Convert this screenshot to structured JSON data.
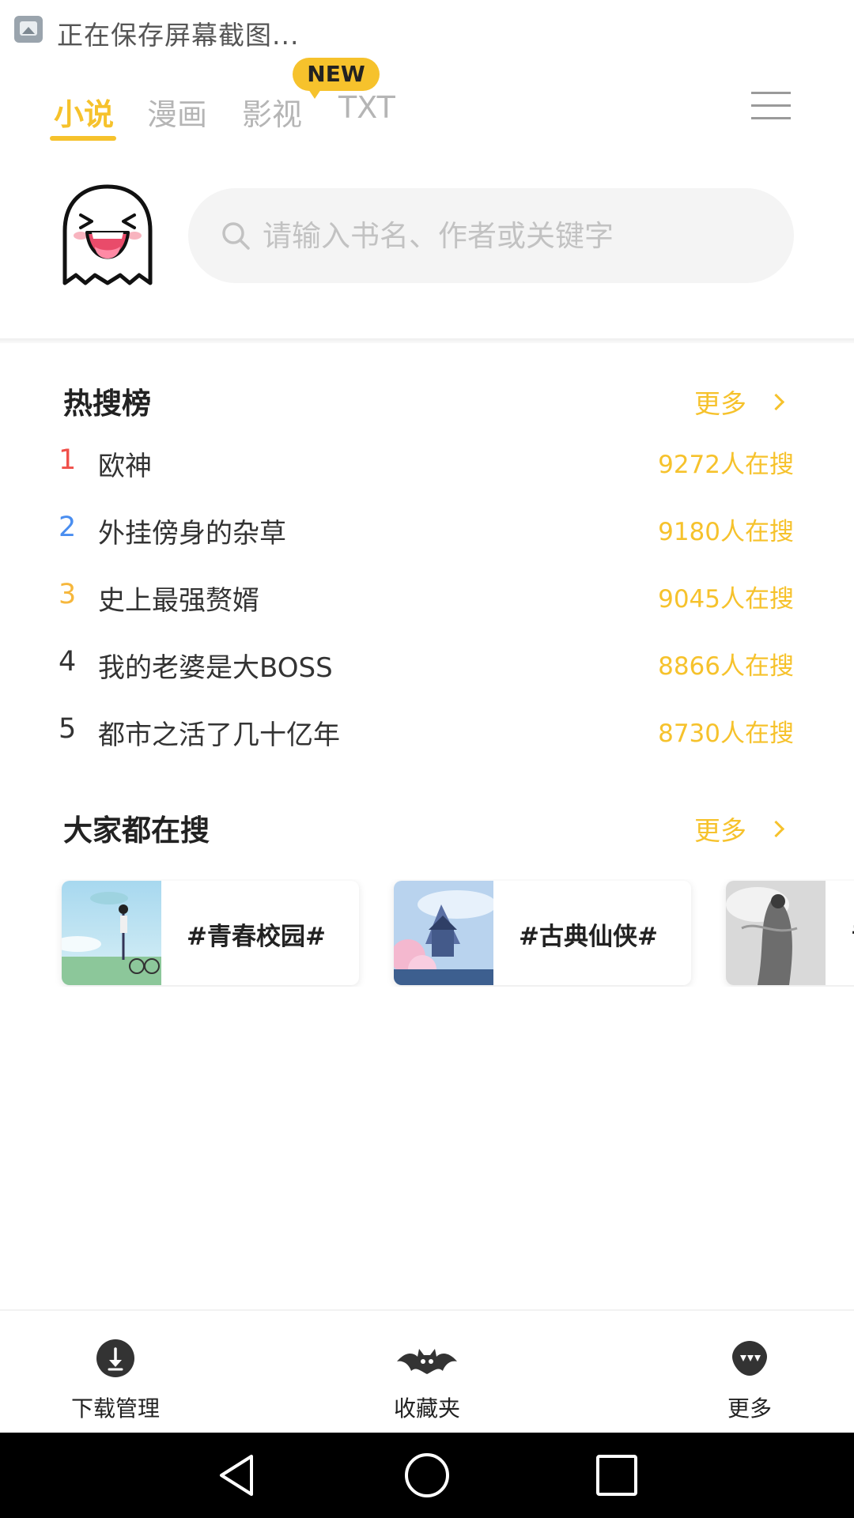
{
  "status_bar": {
    "text": "正在保存屏幕截图..."
  },
  "tabs": [
    {
      "label": "小说",
      "active": true
    },
    {
      "label": "漫画",
      "active": false
    },
    {
      "label": "影视",
      "active": false
    },
    {
      "label": "TXT",
      "active": false
    }
  ],
  "new_badge": "NEW",
  "search": {
    "placeholder": "请输入书名、作者或关键字"
  },
  "hot_search": {
    "title": "热搜榜",
    "more_label": "更多",
    "items": [
      {
        "rank": "1",
        "title": "欧神",
        "count": "9272人在搜",
        "rank_color": "#f0504a"
      },
      {
        "rank": "2",
        "title": "外挂傍身的杂草",
        "count": "9180人在搜",
        "rank_color": "#4a8ef0"
      },
      {
        "rank": "3",
        "title": "史上最强赘婿",
        "count": "9045人在搜",
        "rank_color": "#f6b73c"
      },
      {
        "rank": "4",
        "title": "我的老婆是大BOSS",
        "count": "8866人在搜",
        "rank_color": "#333333"
      },
      {
        "rank": "5",
        "title": "都市之活了几十亿年",
        "count": "8730人在搜",
        "rank_color": "#333333"
      }
    ]
  },
  "popular": {
    "title": "大家都在搜",
    "more_label": "更多",
    "tags": [
      {
        "label": "#青春校园#"
      },
      {
        "label": "#古典仙侠#"
      },
      {
        "label": "#"
      }
    ]
  },
  "bottom_nav": [
    {
      "label": "下载管理",
      "icon": "download-icon"
    },
    {
      "label": "收藏夹",
      "icon": "bat-icon"
    },
    {
      "label": "更多",
      "icon": "more-dots-icon"
    }
  ],
  "colors": {
    "accent": "#f6c22c",
    "rank1": "#f0504a",
    "rank2": "#4a8ef0",
    "rank3": "#f6b73c"
  }
}
